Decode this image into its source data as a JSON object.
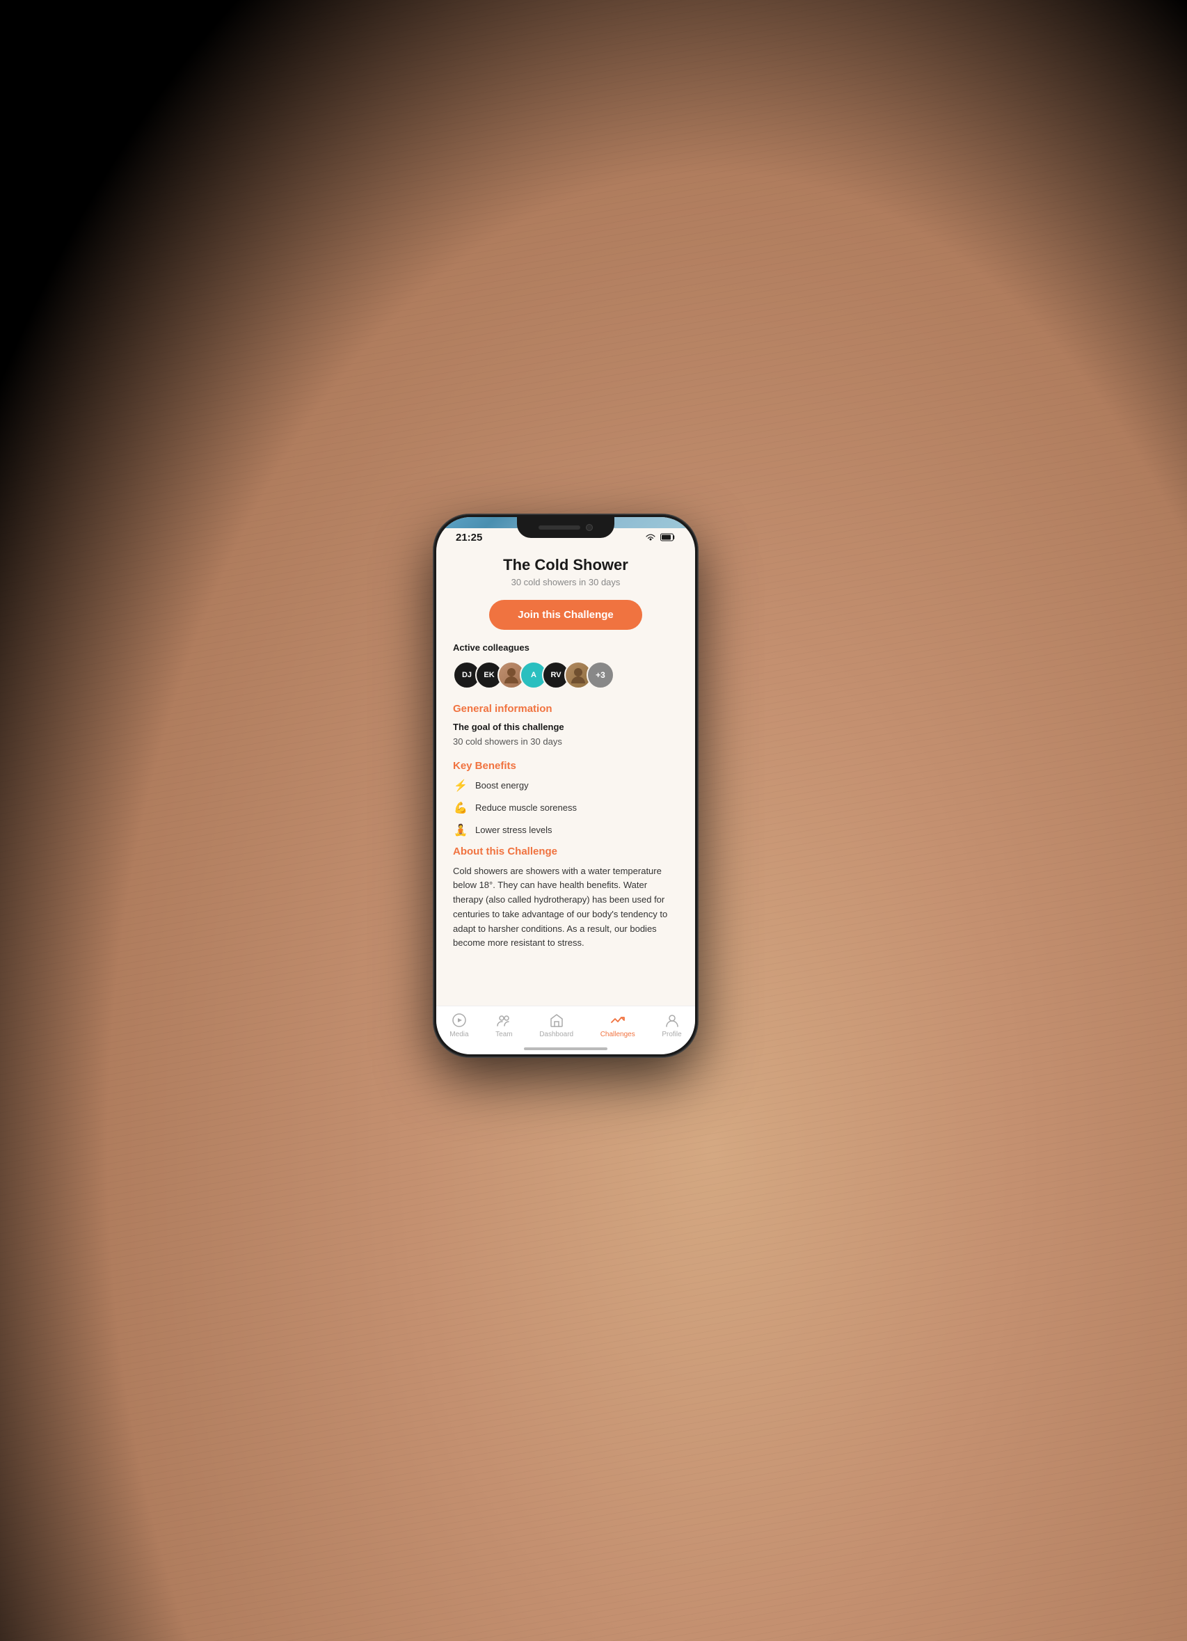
{
  "phone": {
    "status_bar": {
      "time": "21:25"
    },
    "challenge": {
      "title": "The Cold Shower",
      "subtitle": "30 cold showers in 30 days",
      "join_button": "Join this Challenge"
    },
    "colleagues": {
      "label": "Active colleagues",
      "avatars": [
        {
          "initials": "DJ",
          "color": "black"
        },
        {
          "initials": "EK",
          "color": "black"
        },
        {
          "initials": "",
          "color": "photo"
        },
        {
          "initials": "A",
          "color": "teal"
        },
        {
          "initials": "RV",
          "color": "black"
        },
        {
          "initials": "",
          "color": "photo2"
        },
        {
          "initials": "+3",
          "color": "gray"
        }
      ]
    },
    "general_info": {
      "heading": "General information",
      "goal_label": "The goal of this challenge",
      "goal_text": "30 cold showers in 30 days"
    },
    "key_benefits": {
      "heading": "Key Benefits",
      "items": [
        {
          "icon": "⚡",
          "text": "Boost energy"
        },
        {
          "icon": "💪",
          "text": "Reduce muscle soreness"
        },
        {
          "icon": "🧘",
          "text": "Lower stress levels"
        }
      ]
    },
    "about": {
      "heading": "About this Challenge",
      "text": "Cold showers are showers with a water temperature below 18°. They can have health benefits. Water therapy (also called hydrotherapy) has been used for centuries to take advantage of our body's tendency to adapt to harsher conditions. As a result, our bodies become more resistant to stress."
    },
    "bottom_nav": {
      "items": [
        {
          "label": "Media",
          "icon": "media",
          "active": false
        },
        {
          "label": "Team",
          "icon": "team",
          "active": false
        },
        {
          "label": "Dashboard",
          "icon": "dashboard",
          "active": false
        },
        {
          "label": "Challenges",
          "icon": "challenges",
          "active": true
        },
        {
          "label": "Profile",
          "icon": "profile",
          "active": false
        }
      ]
    }
  }
}
